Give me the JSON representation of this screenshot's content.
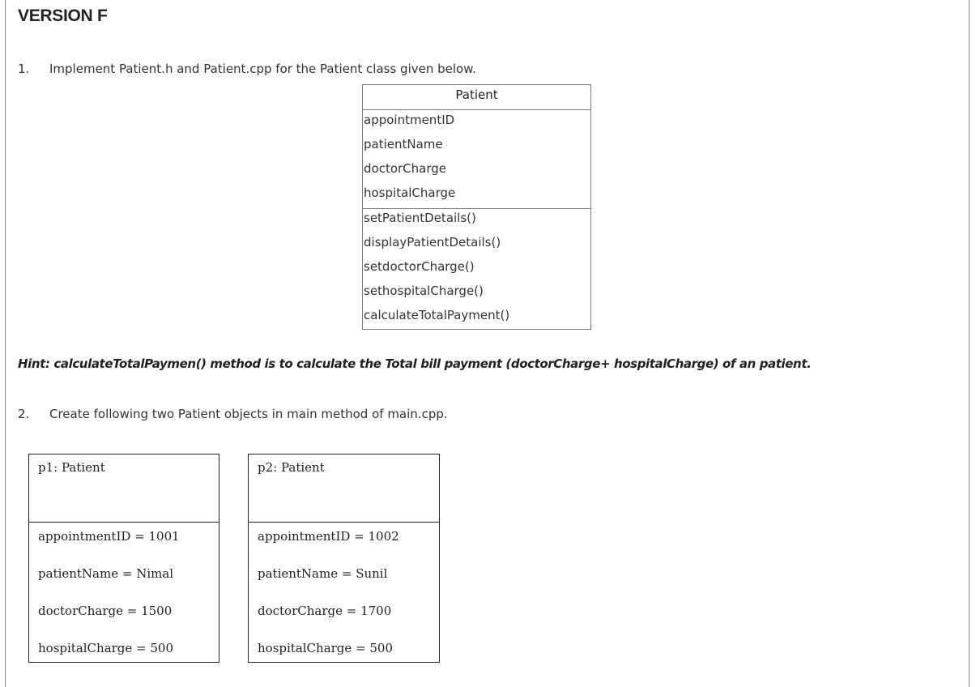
{
  "heading": "VERSION F",
  "question1": {
    "number": "1.",
    "text": "Implement Patient.h and Patient.cpp for the Patient class given below."
  },
  "class_diagram": {
    "name": "Patient",
    "attributes": [
      "appointmentID",
      "patientName",
      "doctorCharge",
      "hospitalCharge"
    ],
    "methods": [
      "setPatientDetails()",
      "displayPatientDetails()",
      "setdoctorCharge()",
      "sethospitalCharge()",
      "calculateTotalPayment()"
    ]
  },
  "hint": "Hint:  calculateTotalPaymen() method is to calculate the Total bill payment (doctorCharge+ hospitalCharge) of an patient.",
  "question2": {
    "number": "2.",
    "text": "Create following two Patient objects in main method of main.cpp."
  },
  "objects": [
    {
      "title": "p1: Patient",
      "fields": [
        "appointmentID = 1001",
        "patientName = Nimal",
        "doctorCharge = 1500",
        "hospitalCharge  = 500"
      ]
    },
    {
      "title": "p2: Patient",
      "fields": [
        "appointmentID = 1002",
        "patientName = Sunil",
        "doctorCharge = 1700",
        "hospitalCharge  = 500"
      ]
    }
  ]
}
